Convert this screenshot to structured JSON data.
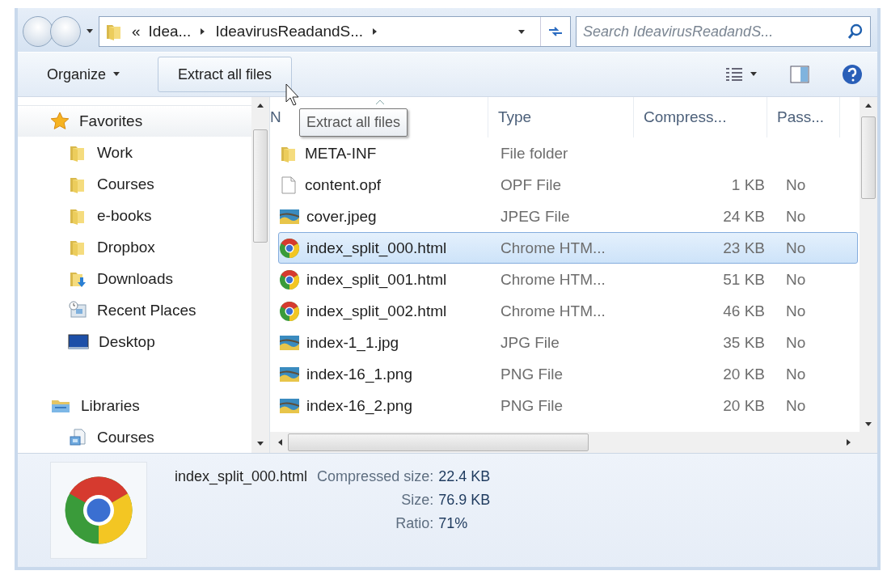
{
  "address_bar": {
    "overflow": "«",
    "path": [
      "Idea...",
      "IdeavirusReadandS..."
    ]
  },
  "search": {
    "placeholder": "Search IdeavirusReadandS..."
  },
  "toolbar": {
    "organize": "Organize",
    "action": "Extract all files"
  },
  "navigation": [
    {
      "label": "Favorites",
      "kind": "star",
      "children": [
        {
          "label": "Work",
          "kind": "folder"
        },
        {
          "label": "Courses",
          "kind": "folder"
        },
        {
          "label": "e-books",
          "kind": "folder"
        },
        {
          "label": "Dropbox",
          "kind": "folder"
        },
        {
          "label": "Downloads",
          "kind": "downloads"
        },
        {
          "label": "Recent Places",
          "kind": "recent"
        },
        {
          "label": "Desktop",
          "kind": "desktop"
        }
      ]
    },
    {
      "label": "Libraries",
      "kind": "library",
      "children": [
        {
          "label": "Courses",
          "kind": "document-library"
        }
      ]
    }
  ],
  "columns": [
    "N",
    "Type",
    "Compress...",
    "Pass..."
  ],
  "tooltip": "Extract all files",
  "rows": [
    {
      "name": "META-INF",
      "kind": "folder",
      "type": "File folder",
      "compressed": "",
      "password": "",
      "selected": false
    },
    {
      "name": "content.opf",
      "kind": "file",
      "type": "OPF File",
      "compressed": "1 KB",
      "password": "No",
      "selected": false
    },
    {
      "name": "cover.jpeg",
      "kind": "image",
      "type": "JPEG File",
      "compressed": "24 KB",
      "password": "No",
      "selected": false
    },
    {
      "name": "index_split_000.html",
      "kind": "chrome",
      "type": "Chrome HTM...",
      "compressed": "23 KB",
      "password": "No",
      "selected": true
    },
    {
      "name": "index_split_001.html",
      "kind": "chrome",
      "type": "Chrome HTM...",
      "compressed": "51 KB",
      "password": "No",
      "selected": false
    },
    {
      "name": "index_split_002.html",
      "kind": "chrome",
      "type": "Chrome HTM...",
      "compressed": "46 KB",
      "password": "No",
      "selected": false
    },
    {
      "name": "index-1_1.jpg",
      "kind": "image",
      "type": "JPG File",
      "compressed": "35 KB",
      "password": "No",
      "selected": false
    },
    {
      "name": "index-16_1.png",
      "kind": "image",
      "type": "PNG File",
      "compressed": "20 KB",
      "password": "No",
      "selected": false
    },
    {
      "name": "index-16_2.png",
      "kind": "image",
      "type": "PNG File",
      "compressed": "20 KB",
      "password": "No",
      "selected": false
    }
  ],
  "details": {
    "name": "index_split_000.html",
    "fields": [
      {
        "label": "Compressed size:",
        "value": "22.4 KB"
      },
      {
        "label": "Size:",
        "value": "76.9 KB"
      },
      {
        "label": "Ratio:",
        "value": "71%"
      }
    ]
  }
}
